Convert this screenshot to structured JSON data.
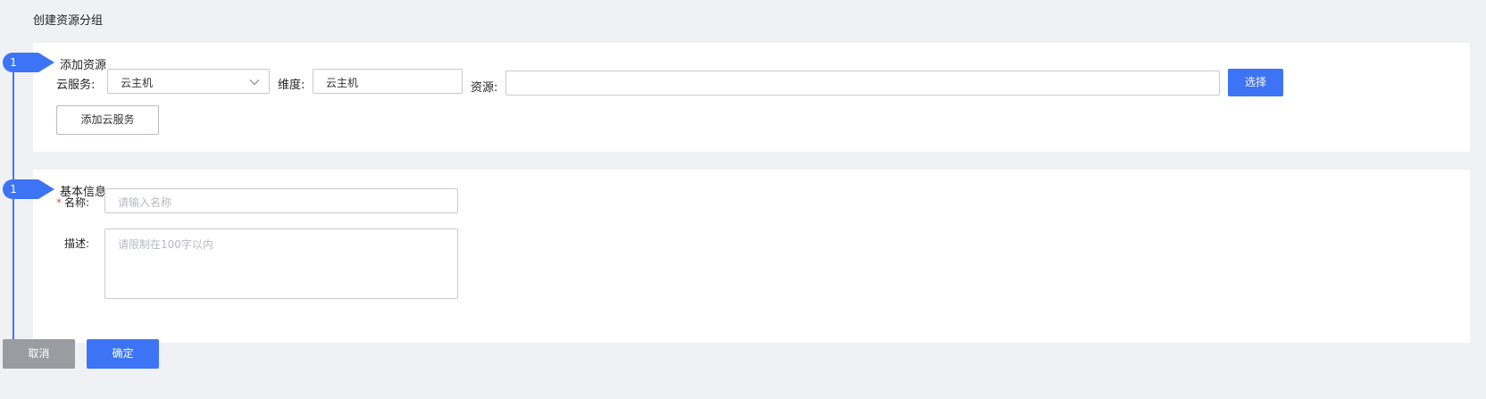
{
  "page": {
    "title": "创建资源分组"
  },
  "steps": [
    {
      "number": "1",
      "title": "添加资源"
    },
    {
      "number": "1",
      "title": "基本信息"
    }
  ],
  "add_resource": {
    "cloud_service_label": "云服务:",
    "cloud_service_value": "云主机",
    "dimension_label": "维度:",
    "dimension_value": "云主机",
    "resource_label": "资源:",
    "resource_value": "",
    "select_button": "选择",
    "add_cloud_service_button": "添加云服务"
  },
  "basic_info": {
    "name_required_mark": "*",
    "name_label": "名称:",
    "name_placeholder": "请输入名称",
    "desc_label": "描述:",
    "desc_placeholder": "请限制在100字以内"
  },
  "footer": {
    "cancel_button": "取消",
    "confirm_button": "确定"
  },
  "colors": {
    "primary": "#3d74f5",
    "background": "#f0f1f5",
    "card": "#ffffff",
    "cancel": "#9a9ca2",
    "required": "#e34d4d"
  }
}
